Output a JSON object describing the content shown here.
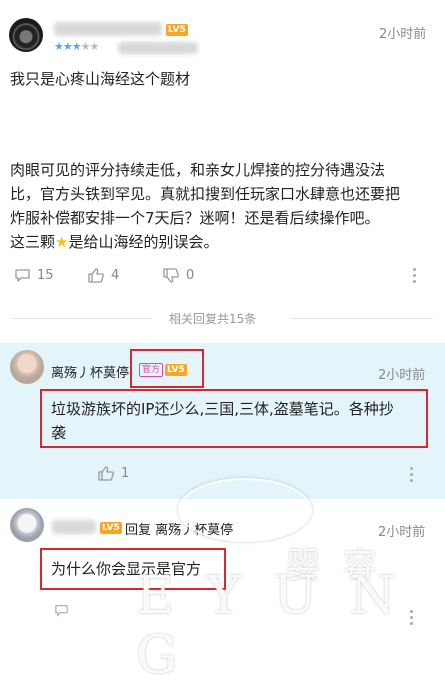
{
  "post": {
    "time": "2小时前",
    "level": "LV5",
    "line1": "我只是心疼山海经这个题材",
    "para_lines": [
      "肉眼可见的评分持续走低，和亲女儿焊接的控分待遇没法",
      "比，官方头铁到罕见。真就扣搜到任玩家口水肆意也还要把",
      "炸服补偿都安排一个7天后？迷啊！还是看后续操作吧。",
      "这三颗"
    ],
    "para_tail": "是给山海经的别误会。",
    "comments": "15",
    "likes": "4",
    "dislikes": "0",
    "rating_stars": 3
  },
  "replies_count_text": "相关回复共15条",
  "reply1": {
    "username": "离殇丿杯莫停",
    "badge_official": "官方",
    "level": "LV5",
    "time": "2小时前",
    "text_line1": "垃圾游族坏的IP还少么,三国,三体,盗墓笔记。各种抄",
    "text_line2": "袭",
    "likes": "1"
  },
  "reply2": {
    "level": "LV5",
    "reply_prefix": "回复 离殇丿杯莫停",
    "time": "2小时前",
    "text": "为什么你会显示是官方"
  },
  "watermark": {
    "cn": "婴 容",
    "en": "E Y U N G"
  },
  "colors": {
    "star": "#f5c518",
    "highlight": "#d9272e",
    "reply_bg": "#e4f4fb",
    "rating": "#5aa9e6"
  }
}
